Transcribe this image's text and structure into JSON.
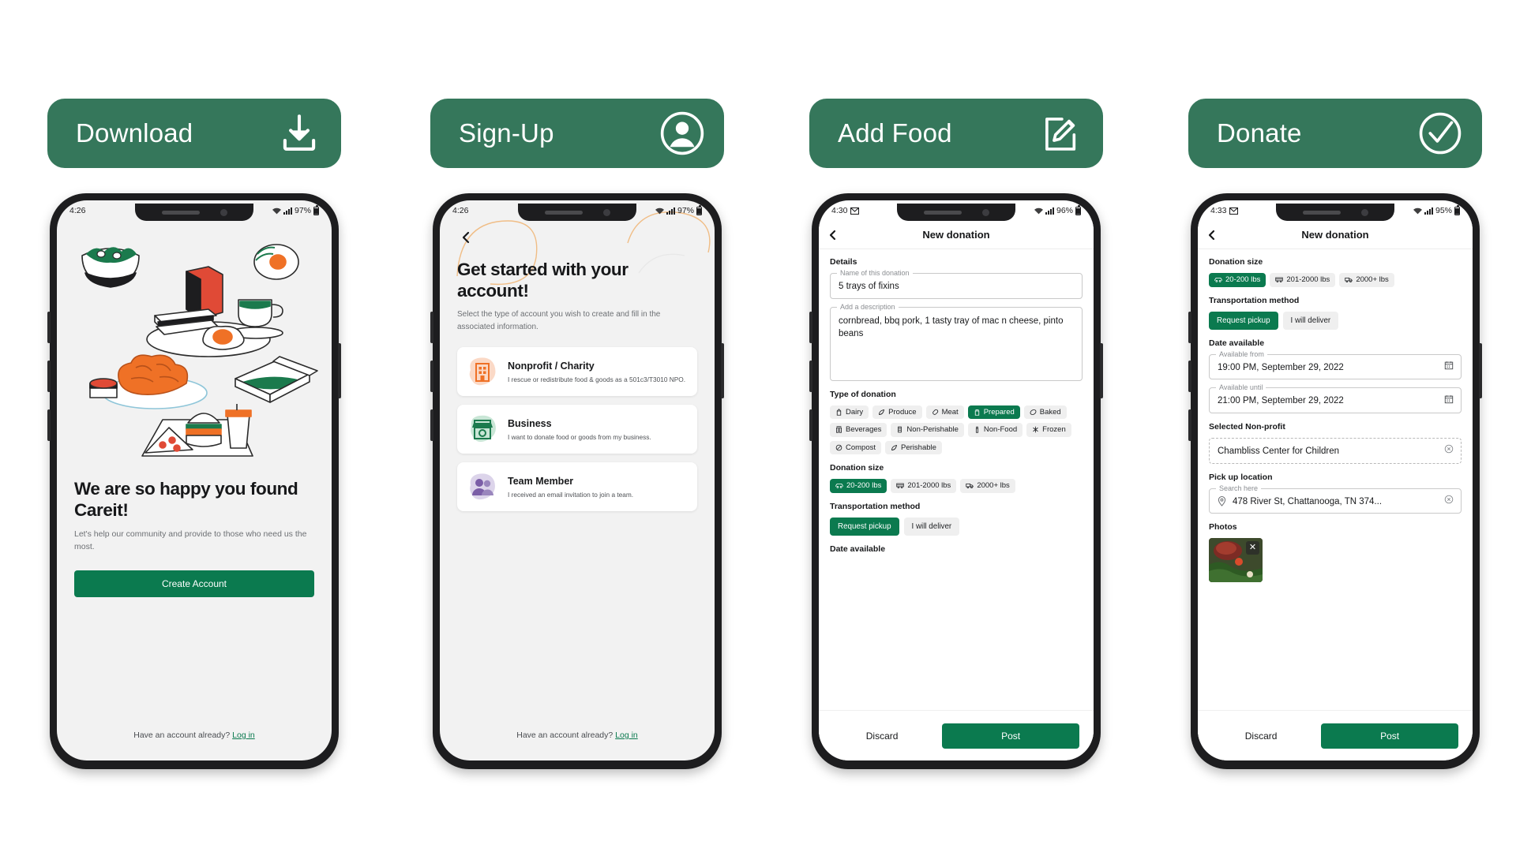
{
  "columns": [
    {
      "banner": {
        "label": "Download",
        "icon": "download-icon"
      },
      "status": {
        "time": "4:26",
        "battery": "97%"
      }
    },
    {
      "banner": {
        "label": "Sign-Up",
        "icon": "user-circle-icon"
      },
      "status": {
        "time": "4:26",
        "battery": "97%"
      }
    },
    {
      "banner": {
        "label": "Add Food",
        "icon": "edit-note-icon"
      },
      "status": {
        "time": "4:30",
        "battery": "96%"
      }
    },
    {
      "banner": {
        "label": "Donate",
        "icon": "check-circle-icon"
      },
      "status": {
        "time": "4:33",
        "battery": "95%"
      }
    }
  ],
  "welcome": {
    "title": "We are so happy you found Careit!",
    "subtitle": "Let's help our community and provide to those who need us the most.",
    "create_account": "Create Account",
    "have_account": "Have an account already?",
    "login": "Log in"
  },
  "signup": {
    "title": "Get started with your account!",
    "subtitle": "Select the type of account you wish to create and fill in the associated information.",
    "cards": [
      {
        "name": "Nonprofit / Charity",
        "desc": "I rescue or redistribute food & goods as a 501c3/T3010 NPO.",
        "icon": "building-icon"
      },
      {
        "name": "Business",
        "desc": "I want to donate food or goods from my business.",
        "icon": "storefront-icon"
      },
      {
        "name": "Team Member",
        "desc": "I received an email invitation to join a team.",
        "icon": "people-icon"
      }
    ],
    "have_account": "Have an account already?",
    "login": "Log in"
  },
  "donation_form": {
    "appbar_title": "New donation",
    "details_label": "Details",
    "name_field": {
      "legend": "Name of this donation",
      "value": "5 trays of fixins"
    },
    "desc_field": {
      "legend": "Add a description",
      "value": "cornbread, bbq pork, 1 tasty tray of mac n cheese, pinto beans"
    },
    "type_label": "Type of donation",
    "types": [
      {
        "label": "Dairy",
        "icon": "dairy-icon",
        "selected": false
      },
      {
        "label": "Produce",
        "icon": "produce-icon",
        "selected": false
      },
      {
        "label": "Meat",
        "icon": "meat-icon",
        "selected": false
      },
      {
        "label": "Prepared",
        "icon": "prepared-icon",
        "selected": true
      },
      {
        "label": "Baked",
        "icon": "baked-icon",
        "selected": false
      },
      {
        "label": "Beverages",
        "icon": "beverages-icon",
        "selected": false
      },
      {
        "label": "Non-Perishable",
        "icon": "can-icon",
        "selected": false
      },
      {
        "label": "Non-Food",
        "icon": "bottle-icon",
        "selected": false
      },
      {
        "label": "Frozen",
        "icon": "snowflake-icon",
        "selected": false
      },
      {
        "label": "Compost",
        "icon": "compost-icon",
        "selected": false
      },
      {
        "label": "Perishable",
        "icon": "perishable-icon",
        "selected": false
      }
    ],
    "size_label": "Donation size",
    "sizes": [
      {
        "label": "20-200 lbs",
        "icon": "car-icon",
        "selected": true
      },
      {
        "label": "201-2000 lbs",
        "icon": "van-icon",
        "selected": false
      },
      {
        "label": "2000+ lbs",
        "icon": "truck-icon",
        "selected": false
      }
    ],
    "transport_label": "Transportation method",
    "transport": [
      {
        "label": "Request pickup",
        "selected": true
      },
      {
        "label": "I will deliver",
        "selected": false
      }
    ],
    "date_label": "Date available",
    "available_from": {
      "legend": "Available from",
      "value": "19:00 PM, September 29, 2022",
      "icon": "calendar-icon"
    },
    "available_until": {
      "legend": "Available until",
      "value": "21:00 PM, September 29, 2022",
      "icon": "calendar-icon"
    },
    "nonprofit_label": "Selected Non-profit",
    "nonprofit_value": "Chambliss Center for Children",
    "pickup_label": "Pick up location",
    "pickup_field": {
      "legend": "Search here",
      "value": "478 River St, Chattanooga, TN 374...",
      "icon": "pin-icon"
    },
    "photos_label": "Photos",
    "discard": "Discard",
    "post": "Post"
  },
  "colors": {
    "banner_green": "#35775B",
    "accent_green": "#0b7a4f",
    "chip_bg": "#efefef",
    "screen_bg": "#f2f2f2"
  }
}
